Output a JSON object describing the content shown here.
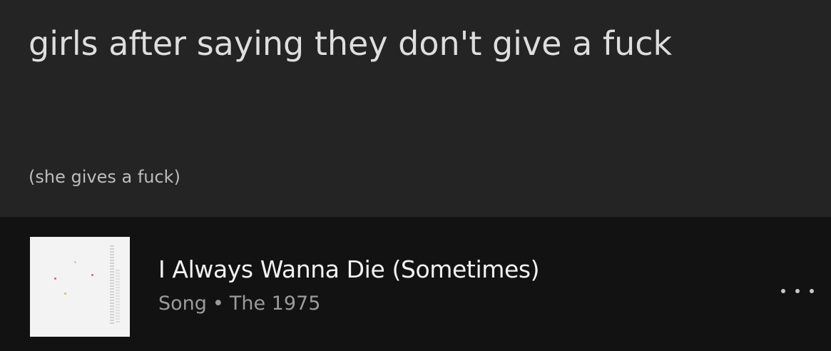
{
  "post": {
    "title": "girls after saying they don't give a fuck",
    "subtitle": "(she gives a fuck)"
  },
  "track": {
    "title": "I Always Wanna Die (Sometimes)",
    "type": "Song",
    "separator": "•",
    "artist": "The 1975",
    "more_icon": "more-options-icon"
  },
  "colors": {
    "post_background": "#242424",
    "track_background": "#121212",
    "title_text": "#dedede",
    "secondary_text": "#9b9b9b"
  }
}
